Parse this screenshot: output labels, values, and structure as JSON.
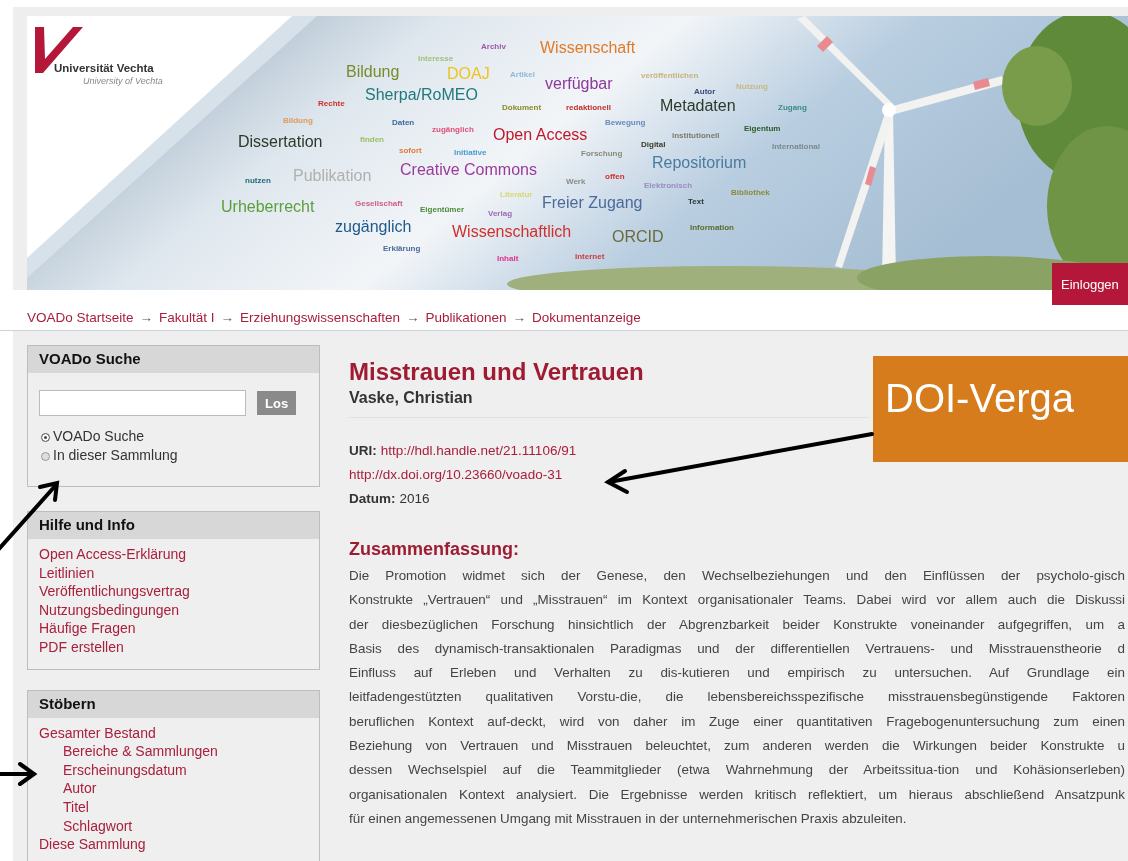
{
  "header": {
    "logo": {
      "name": "Universität Vechta",
      "subtitle": "University of Vechta"
    },
    "word_cloud": [
      {
        "text": "Archiv",
        "color": "#9b59a6",
        "kind": "small"
      },
      {
        "text": "Wissenschaft",
        "color": "#e07b2a",
        "kind": "large"
      },
      {
        "text": "Interesse",
        "color": "#9bc47a",
        "kind": "small"
      },
      {
        "text": "Bildung",
        "color": "#7a8a2a",
        "kind": "large"
      },
      {
        "text": "DOAJ",
        "color": "#f0c419",
        "kind": "large"
      },
      {
        "text": "Artikel",
        "color": "#8fb8d8",
        "kind": "small"
      },
      {
        "text": "veröffentlichen",
        "color": "#c8b27a",
        "kind": "small"
      },
      {
        "text": "Sherpa/RoMEO",
        "color": "#1f7a7a",
        "kind": "large"
      },
      {
        "text": "verfügbar",
        "color": "#8b3a9b",
        "kind": "large"
      },
      {
        "text": "Autor",
        "color": "#3a4a7a",
        "kind": "small"
      },
      {
        "text": "Nutzung",
        "color": "#c8b880",
        "kind": "small"
      },
      {
        "text": "Rechte",
        "color": "#d0302a",
        "kind": "small"
      },
      {
        "text": "Dokument",
        "color": "#8a8a2a",
        "kind": "small"
      },
      {
        "text": "redaktionell",
        "color": "#c0302a",
        "kind": "small"
      },
      {
        "text": "Metadaten",
        "color": "#2a3a2a",
        "kind": "large"
      },
      {
        "text": "Zugang",
        "color": "#3a8a8a",
        "kind": "small"
      },
      {
        "text": "Bildung",
        "color": "#e09a5a",
        "kind": "small"
      },
      {
        "text": "Daten",
        "color": "#3a6aa0",
        "kind": "small"
      },
      {
        "text": "Bewegung",
        "color": "#6a8ac0",
        "kind": "small"
      },
      {
        "text": "zugänglich",
        "color": "#e0507a",
        "kind": "small"
      },
      {
        "text": "Open Access",
        "color": "#c0182a",
        "kind": "large"
      },
      {
        "text": "institutionell",
        "color": "#7a7a6a",
        "kind": "small"
      },
      {
        "text": "Eigentum",
        "color": "#2a5a2a",
        "kind": "small"
      },
      {
        "text": "Dissertation",
        "color": "#2a3a2a",
        "kind": "large"
      },
      {
        "text": "finden",
        "color": "#9ac060",
        "kind": "small"
      },
      {
        "text": "Digital",
        "color": "#3a3a2a",
        "kind": "small"
      },
      {
        "text": "International",
        "color": "#7a8a8a",
        "kind": "small"
      },
      {
        "text": "sofort",
        "color": "#e07a3a",
        "kind": "small"
      },
      {
        "text": "Initiative",
        "color": "#4a9ad0",
        "kind": "small"
      },
      {
        "text": "Forschung",
        "color": "#8a8a7a",
        "kind": "small"
      },
      {
        "text": "Creative Commons",
        "color": "#9a3a9a",
        "kind": "large"
      },
      {
        "text": "Repositorium",
        "color": "#4a7aa0",
        "kind": "large"
      },
      {
        "text": "nutzen",
        "color": "#1f6a7a",
        "kind": "small"
      },
      {
        "text": "Publikation",
        "color": "#b0b0b0",
        "kind": "large"
      },
      {
        "text": "Werk",
        "color": "#8a8a8a",
        "kind": "small"
      },
      {
        "text": "offen",
        "color": "#d0302a",
        "kind": "small"
      },
      {
        "text": "Elektronisch",
        "color": "#9a8ac0",
        "kind": "small"
      },
      {
        "text": "Literatur",
        "color": "#d8d870",
        "kind": "small"
      },
      {
        "text": "Bibliothek",
        "color": "#8a8a3a",
        "kind": "small"
      },
      {
        "text": "Urheberrecht",
        "color": "#5aa03a",
        "kind": "large"
      },
      {
        "text": "Gesellschaft",
        "color": "#d05a8a",
        "kind": "small"
      },
      {
        "text": "Eigentümer",
        "color": "#4a8a3a",
        "kind": "small"
      },
      {
        "text": "Verlag",
        "color": "#9a6ab0",
        "kind": "small"
      },
      {
        "text": "Freier Zugang",
        "color": "#4a6a9a",
        "kind": "large"
      },
      {
        "text": "Text",
        "color": "#2a3a3a",
        "kind": "small"
      },
      {
        "text": "zugänglich",
        "color": "#1f5a8a",
        "kind": "large"
      },
      {
        "text": "Wissenschaftlich",
        "color": "#d0302a",
        "kind": "large"
      },
      {
        "text": "ORCID",
        "color": "#6a6a3a",
        "kind": "large"
      },
      {
        "text": "Information",
        "color": "#5a6a2a",
        "kind": "small"
      },
      {
        "text": "Erklärung",
        "color": "#4a6a9a",
        "kind": "small"
      },
      {
        "text": "Inhalt",
        "color": "#e0308a",
        "kind": "small"
      },
      {
        "text": "Internet",
        "color": "#d03a3a",
        "kind": "small"
      }
    ],
    "login_button": "Einloggen"
  },
  "breadcrumb": [
    {
      "text": "VOADo Startseite",
      "kind": "link"
    },
    {
      "text": "→",
      "kind": "separator"
    },
    {
      "text": "Fakultät I",
      "kind": "link"
    },
    {
      "text": "→",
      "kind": "separator"
    },
    {
      "text": "Erziehungswissenschaften",
      "kind": "link"
    },
    {
      "text": "→",
      "kind": "separator"
    },
    {
      "text": "Publikationen",
      "kind": "link"
    },
    {
      "text": "→",
      "kind": "separator"
    },
    {
      "text": "Dokumentanzeige",
      "kind": "link"
    }
  ],
  "sidebar": {
    "search": {
      "title": "VOADo Suche",
      "button": "Los",
      "options": [
        {
          "label": "VOADo Suche",
          "selected": true
        },
        {
          "label": "In dieser Sammlung",
          "selected": false
        }
      ]
    },
    "help": {
      "title": "Hilfe und Info",
      "links": [
        "Open Access-Erklärung",
        "Leitlinien",
        "Veröffentlichungsvertrag",
        "Nutzungsbedingungen",
        "Häufige Fragen",
        "PDF erstellen"
      ]
    },
    "browse": {
      "title": "Stöbern",
      "items": [
        {
          "label": "Gesamter Bestand",
          "children": [
            {
              "label": "Bereiche & Sammlungen"
            },
            {
              "label": "Erscheinungsdatum"
            },
            {
              "label": "Autor"
            },
            {
              "label": "Titel"
            },
            {
              "label": "Schlagwort"
            }
          ]
        },
        {
          "label": "Diese Sammlung"
        }
      ]
    }
  },
  "item": {
    "title": "Misstrauen und Vertrauen",
    "author": "Vaske, Christian",
    "uri_label": "URI:",
    "uri": "http://hdl.handle.net/21.11106/91",
    "doi": "http://dx.doi.org/10.23660/voado-31",
    "date_label": "Datum:",
    "date": "2016",
    "abstract_title": "Zusammenfassung:",
    "abstract_lines": [
      "Die Promotion widmet sich der Genese, den Wechselbeziehungen und den Einflüssen der psycholo-gisch",
      "Konstrukte „Vertrauen“ und „Misstrauen“ im Kontext organisationaler Teams. Dabei wird vor allem auch die Diskussi",
      "der diesbezüglichen Forschung hinsichtlich der Abgrenzbarkeit beider Konstrukte voneinander aufgegriffen, um a",
      "Basis des dynamisch-transaktionalen Paradigmas und der differentiellen Vertrauens- und Misstrauenstheorie d",
      "Einfluss auf Erleben und Verhalten zu dis-kutieren und empirisch zu untersuchen. Auf Grundlage ein",
      "leitfadengestützten qualitativen Vorstu-die, die lebensbereichsspezifische misstrauensbegünstigende Faktoren",
      "beruflichen Kontext auf-deckt, wird von daher im Zuge einer quantitativen Fragebogenuntersuchung zum einen",
      "Beziehung von Vertrauen und Misstrauen beleuchtet, zum anderen werden die Wirkungen beider Konstrukte u",
      "dessen Wechselspiel auf die Teammitglieder (etwa Wahrnehmung der Arbeitssitua-tion und Kohäsionserleben)",
      "organisationalen Kontext analysiert. Die Ergebnisse werden kritisch reflektiert, um hieraus abschließend Ansatzpunk",
      "für einen angemessenen Umgang mit Misstrauen in der unternehmerischen Praxis abzuleiten."
    ]
  },
  "annotation": {
    "callout": "DOI-Verga"
  }
}
